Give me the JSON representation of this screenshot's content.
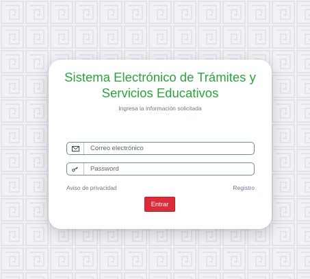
{
  "login": {
    "title": "Sistema Electrónico de Trámites y Servicios Educativos",
    "subtitle": "Ingresa la información solicitada",
    "email": {
      "placeholder": "Correo electrónico",
      "value": "",
      "icon": "envelope-icon"
    },
    "password": {
      "placeholder": "Password",
      "value": "",
      "icon": "key-icon"
    },
    "privacy_link": "Aviso de privacidad",
    "register_link": "Registro",
    "submit_label": "Entrar"
  },
  "colors": {
    "title": "#2aa33b",
    "button": "#dd2b3a",
    "muted_text": "#6b7a8c",
    "background": "#f1f2f5",
    "field_border": "#6b8e7d"
  }
}
